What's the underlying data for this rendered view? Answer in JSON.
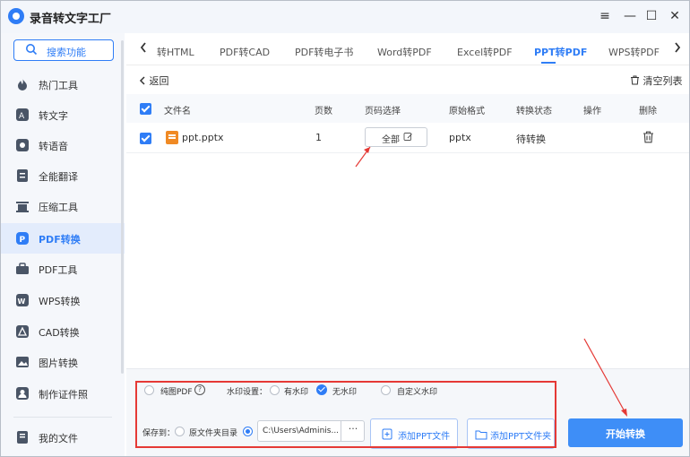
{
  "app": {
    "title": "录音转文字工厂",
    "window_controls": [
      "≡",
      "—",
      "☐",
      "✕"
    ]
  },
  "sidebar": {
    "search_label": "搜索功能",
    "items": [
      {
        "label": "热门工具",
        "icon": "flame-icon"
      },
      {
        "label": "转文字",
        "icon": "text-convert-icon"
      },
      {
        "label": "转语音",
        "icon": "voice-icon"
      },
      {
        "label": "全能翻译",
        "icon": "translate-icon"
      },
      {
        "label": "压缩工具",
        "icon": "compress-icon"
      },
      {
        "label": "PDF转换",
        "icon": "pdf-convert-icon",
        "active": true
      },
      {
        "label": "PDF工具",
        "icon": "toolbox-icon"
      },
      {
        "label": "WPS转换",
        "icon": "wps-icon"
      },
      {
        "label": "CAD转换",
        "icon": "cad-icon"
      },
      {
        "label": "图片转换",
        "icon": "image-icon"
      },
      {
        "label": "制作证件照",
        "icon": "id-photo-icon"
      }
    ],
    "footer_item": {
      "label": "我的文件",
      "icon": "folder-icon"
    }
  },
  "tabs": {
    "items": [
      "转HTML",
      "PDF转CAD",
      "PDF转电子书",
      "Word转PDF",
      "Excel转PDF",
      "PPT转PDF",
      "WPS转PDF"
    ],
    "active": "PPT转PDF"
  },
  "toolbar": {
    "back_label": "返回",
    "clear_label": "清空列表"
  },
  "table": {
    "columns": [
      "文件名",
      "页数",
      "页码选择",
      "原始格式",
      "转换状态",
      "操作",
      "删除"
    ],
    "rows": [
      {
        "filename": "ppt.pptx",
        "pages": "1",
        "page_select": "全部",
        "format": "pptx",
        "status": "待转换"
      }
    ]
  },
  "settings": {
    "pure_image_label": "纯图PDF",
    "help_glyph": "?",
    "watermark_label": "水印设置：",
    "watermark_options": [
      "有水印",
      "无水印",
      "自定义水印"
    ],
    "watermark_selected": "无水印",
    "save_to_label": "保存到：",
    "save_options": [
      "原文件夹目录"
    ],
    "path_value": "C:\\Users\\Adminis...",
    "browse_label": "···",
    "add_file_label": "添加PPT文件",
    "add_folder_label": "添加PPT文件夹",
    "start_label": "开始转换"
  },
  "colors": {
    "accent": "#2f7df6",
    "annotation": "#e53935",
    "ppt_icon": "#f08a24"
  }
}
